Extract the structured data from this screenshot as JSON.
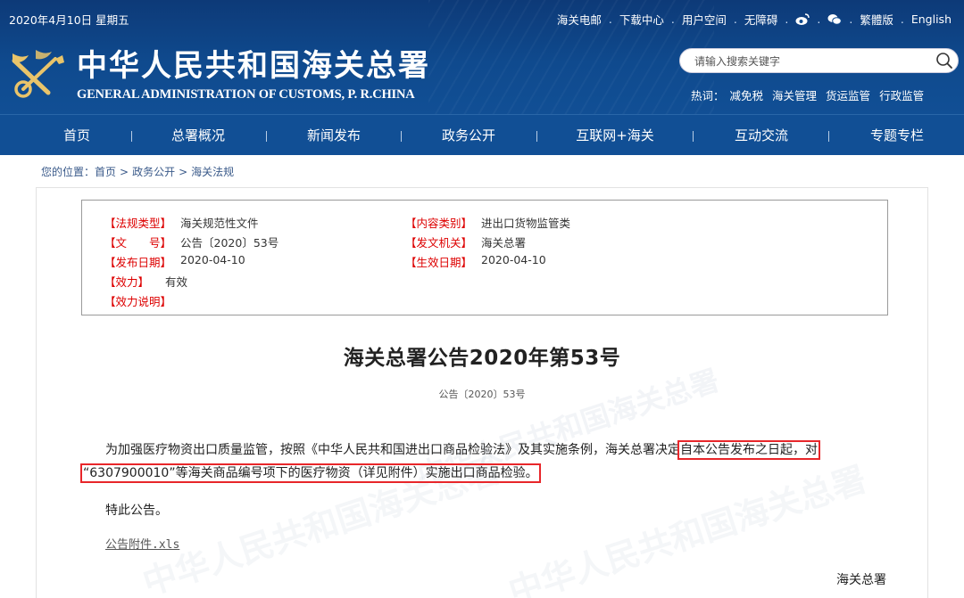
{
  "header": {
    "date": "2020年4月10日 星期五",
    "toplinks": {
      "mail": "海关电邮",
      "download": "下载中心",
      "user_space": "用户空间",
      "accessibility": "无障碍",
      "traditional": "繁體版",
      "english": "English"
    },
    "title_cn": "中华人民共和国海关总署",
    "title_en": "GENERAL ADMINISTRATION OF CUSTOMS, P. R.CHINA",
    "search": {
      "placeholder": "请输入搜索关键字"
    },
    "hot": {
      "label": "热词：",
      "items": [
        "减免税",
        "海关管理",
        "货运监管",
        "行政监管"
      ]
    }
  },
  "nav": {
    "items": [
      "首页",
      "总署概况",
      "新闻发布",
      "政务公开",
      "互联网+海关",
      "互动交流",
      "专题专栏"
    ]
  },
  "breadcrumb": {
    "prefix": "您的位置：",
    "items": [
      "首页",
      "政务公开",
      "海关法规"
    ]
  },
  "meta": {
    "law_type": {
      "key": "【法规类型】",
      "value": "海关规范性文件"
    },
    "content_type": {
      "key": "【内容类别】",
      "value": "进出口货物监管类"
    },
    "doc_no": {
      "key": "【文　　号】",
      "value": "公告〔2020〕53号"
    },
    "issuer": {
      "key": "【发文机关】",
      "value": "海关总署"
    },
    "publish_date": {
      "key": "【发布日期】",
      "value": "2020-04-10"
    },
    "effective_date": {
      "key": "【生效日期】",
      "value": "2020-04-10"
    },
    "validity": {
      "key": "【效力】",
      "value": "有效"
    },
    "validity_note": {
      "key": "【效力说明】",
      "value": ""
    }
  },
  "article": {
    "title": "海关总署公告2020年第53号",
    "doc_no": "公告〔2020〕53号",
    "para1_a": "为加强医疗物资出口质量监管，按照《中华人民共和国进出口商品检验法》及其实施条例，海关总署决定",
    "para1_hl": "自本公告发布之日起，对",
    "para2_hl": "“6307900010”等海关商品编号项下的医疗物资（详见附件）实施出口商品检验。",
    "closing": "特此公告。",
    "attachment": "公告附件.xls",
    "signature": "海关总署"
  },
  "colors": {
    "header_bg": "#0f4a8e",
    "nav_bg": "#114f95",
    "meta_key": "#dd0000",
    "highlight": "#e8262a"
  }
}
